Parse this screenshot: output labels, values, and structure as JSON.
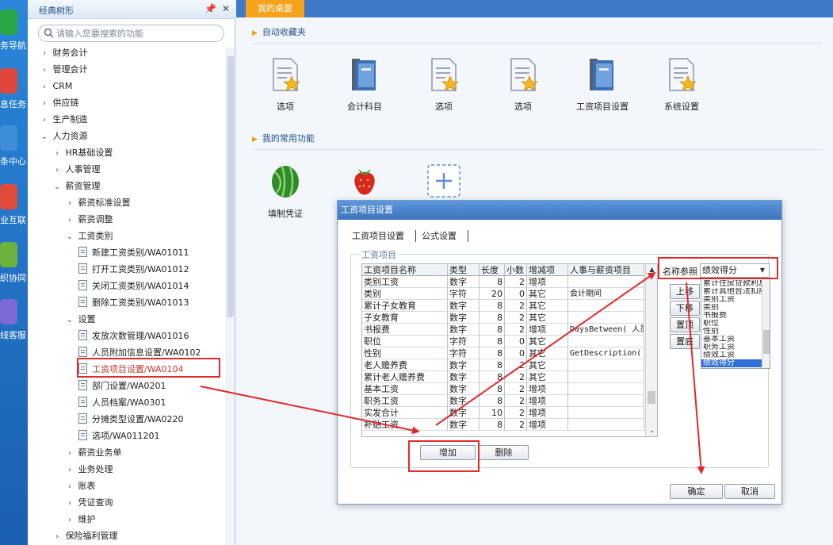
{
  "rail": {
    "items": [
      {
        "label": "务导航",
        "icon": "nav-icon",
        "color": "#27a844"
      },
      {
        "label": "息任务",
        "icon": "task-icon",
        "color": "#e0463b"
      },
      {
        "label": "条中心",
        "icon": "message-center-icon",
        "color": "#3f8fd8"
      },
      {
        "label": "业互联",
        "icon": "interconnect-icon",
        "color": "#e04b3a"
      },
      {
        "label": "织协同",
        "icon": "collaboration-icon",
        "color": "#6cb33e"
      },
      {
        "label": "线客服",
        "icon": "service-icon",
        "color": "#7e6ad6"
      }
    ]
  },
  "tree": {
    "title": "经典树形",
    "search_placeholder": "请输入您要搜索的功能",
    "nodes": [
      {
        "label": "财务会计",
        "arrow": "›"
      },
      {
        "label": "管理会计",
        "arrow": "›"
      },
      {
        "label": "CRM",
        "arrow": "›"
      },
      {
        "label": "供应链",
        "arrow": "›"
      },
      {
        "label": "生产制造",
        "arrow": "›"
      },
      {
        "label": "人力资源",
        "arrow": "⌄"
      },
      {
        "label": "HR基础设置",
        "arrow": "›"
      },
      {
        "label": "人事管理",
        "arrow": "›"
      },
      {
        "label": "薪资管理",
        "arrow": "⌄"
      },
      {
        "label": "薪资标准设置",
        "arrow": "›"
      },
      {
        "label": "薪资调整",
        "arrow": "›"
      },
      {
        "label": "工资类别",
        "arrow": "⌄"
      },
      {
        "label": "新建工资类别/WA01011",
        "arrow": ""
      },
      {
        "label": "打开工资类别/WA01012",
        "arrow": ""
      },
      {
        "label": "关闭工资类别/WA01014",
        "arrow": ""
      },
      {
        "label": "删除工资类别/WA01013",
        "arrow": ""
      },
      {
        "label": "设置",
        "arrow": "⌄"
      },
      {
        "label": "发放次数管理/WA01016",
        "arrow": ""
      },
      {
        "label": "人员附加信息设置/WA0102",
        "arrow": ""
      },
      {
        "label": "工资项目设置/WA0104",
        "arrow": ""
      },
      {
        "label": "部门设置/WA0201",
        "arrow": ""
      },
      {
        "label": "人员档案/WA0301",
        "arrow": ""
      },
      {
        "label": "分摊类型设置/WA0220",
        "arrow": ""
      },
      {
        "label": "选项/WA011201",
        "arrow": ""
      },
      {
        "label": "薪资业务单",
        "arrow": "›"
      },
      {
        "label": "业务处理",
        "arrow": "›"
      },
      {
        "label": "账表",
        "arrow": "›"
      },
      {
        "label": "凭证查询",
        "arrow": "›"
      },
      {
        "label": "维护",
        "arrow": "›"
      },
      {
        "label": "保险福利管理",
        "arrow": "›"
      }
    ]
  },
  "main": {
    "tab_label": "我的桌面",
    "favorites_title": "自动收藏夹",
    "favorites": [
      {
        "label": "选项",
        "icon": "doc-star-icon"
      },
      {
        "label": "会计科目",
        "icon": "books-icon"
      },
      {
        "label": "选项",
        "icon": "doc-star-icon"
      },
      {
        "label": "选项",
        "icon": "doc-star-icon"
      },
      {
        "label": "工资项目设置",
        "icon": "books-icon"
      },
      {
        "label": "系统设置",
        "icon": "doc-star-icon"
      }
    ],
    "common_title": "我的常用功能",
    "common": [
      {
        "label": "填制凭证",
        "icon": "watermelon-icon"
      },
      {
        "label": "",
        "icon": "strawberry-icon"
      },
      {
        "label": "",
        "icon": "add-icon"
      }
    ]
  },
  "dialog": {
    "title": "工资项目设置",
    "tabs": [
      "工资项目设置",
      "公式设置"
    ],
    "group_label": "工资项目",
    "columns": [
      "工资项目名称",
      "类型",
      "长度",
      "小数",
      "增减项",
      "人事与薪资项目"
    ],
    "rows": [
      [
        "类别工资",
        "数字",
        "8",
        "2",
        "增项",
        ""
      ],
      [
        "类别",
        "字符",
        "20",
        "0",
        "其它",
        "会计期间"
      ],
      [
        "累计子女教育",
        "数字",
        "8",
        "2",
        "其它",
        ""
      ],
      [
        "子女教育",
        "数字",
        "8",
        "2",
        "其它",
        ""
      ],
      [
        "书报费",
        "数字",
        "8",
        "2",
        "增项",
        "DaysBetween( 人员"
      ],
      [
        "职位",
        "字符",
        "8",
        "0",
        "其它",
        ""
      ],
      [
        "性别",
        "字符",
        "8",
        "0",
        "其它",
        "GetDescription( ,"
      ],
      [
        "老人赡养费",
        "数字",
        "8",
        "2",
        "其它",
        ""
      ],
      [
        "累计老人赡养费",
        "数字",
        "8",
        "2",
        "其它",
        ""
      ],
      [
        "基本工资",
        "数字",
        "8",
        "2",
        "增项",
        ""
      ],
      [
        "职务工资",
        "数字",
        "8",
        "2",
        "增项",
        ""
      ],
      [
        "实发合计",
        "数字",
        "10",
        "2",
        "增项",
        ""
      ],
      [
        "补贴工资",
        "数字",
        "8",
        "2",
        "增项",
        ""
      ]
    ],
    "name_ref_label": "名称参照",
    "name_ref_value": "绩效得分",
    "name_list": [
      "累计住房贷款利息",
      "累计其他合法扣除",
      "类别工资",
      "类别",
      "书报费",
      "职位",
      "性别",
      "基本工资",
      "职务工资",
      "绩效工资",
      "绩效得分"
    ],
    "side_buttons": [
      "上移",
      "下移",
      "置顶",
      "置底"
    ],
    "add_label": "增加",
    "delete_label": "删除",
    "ok_label": "确定",
    "cancel_label": "取消"
  },
  "colors": {
    "accent_tab": "#f7a21b",
    "tabbar": "#3d7bc8",
    "highlight_red": "#e02b2b",
    "selection_blue": "#2f6fd6"
  }
}
